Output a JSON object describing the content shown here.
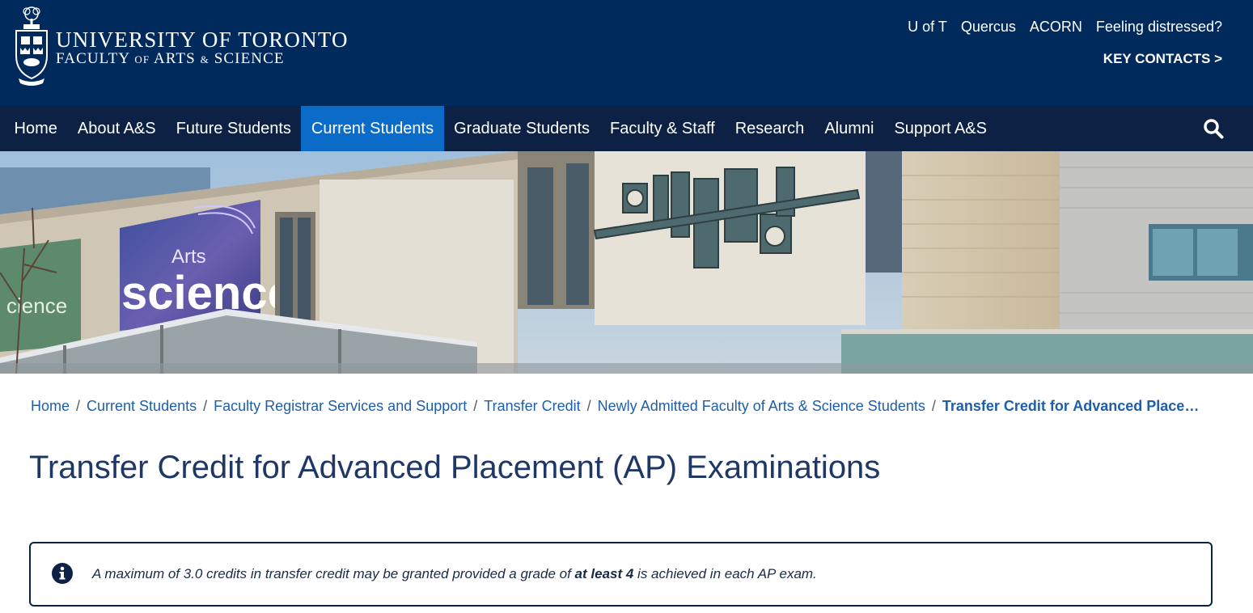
{
  "header": {
    "university": "UNIVERSITY OF TORONTO",
    "faculty_part1": "FACULTY",
    "faculty_of": "OF",
    "faculty_part2": "ARTS",
    "faculty_amp": "&",
    "faculty_part3": "SCIENCE",
    "util_links": [
      "U of T",
      "Quercus",
      "ACORN",
      "Feeling distressed?"
    ],
    "key_contacts": "KEY CONTACTS >"
  },
  "nav": {
    "items": [
      "Home",
      "About A&S",
      "Future Students",
      "Current Students",
      "Graduate Students",
      "Faculty & Staff",
      "Research",
      "Alumni",
      "Support A&S"
    ],
    "active": "Current Students",
    "search_icon": "search-icon"
  },
  "hero": {
    "banner_word_small": "Arts",
    "banner_word_big": "science",
    "banner_word_left": "cience"
  },
  "breadcrumb": {
    "items": [
      "Home",
      "Current Students",
      "Faculty Registrar Services and Support",
      "Transfer Credit",
      "Newly Admitted Faculty of Arts & Science Students"
    ],
    "separator": "/",
    "current": "Transfer Credit for Advanced Placement (AP) Examinations"
  },
  "page": {
    "title": "Transfer Credit for Advanced Placement (AP) Examinations"
  },
  "info": {
    "icon": "info-circle-icon",
    "text_before": "A maximum of 3.0 credits in transfer credit may be granted provided a grade of ",
    "text_bold": "at least 4",
    "text_after": " is achieved in each AP exam."
  },
  "colors": {
    "header_bg": "#002a5c",
    "nav_bg": "#0d2144",
    "nav_active": "#0a6bc9",
    "link": "#1f5ea8",
    "title": "#1e3765"
  }
}
